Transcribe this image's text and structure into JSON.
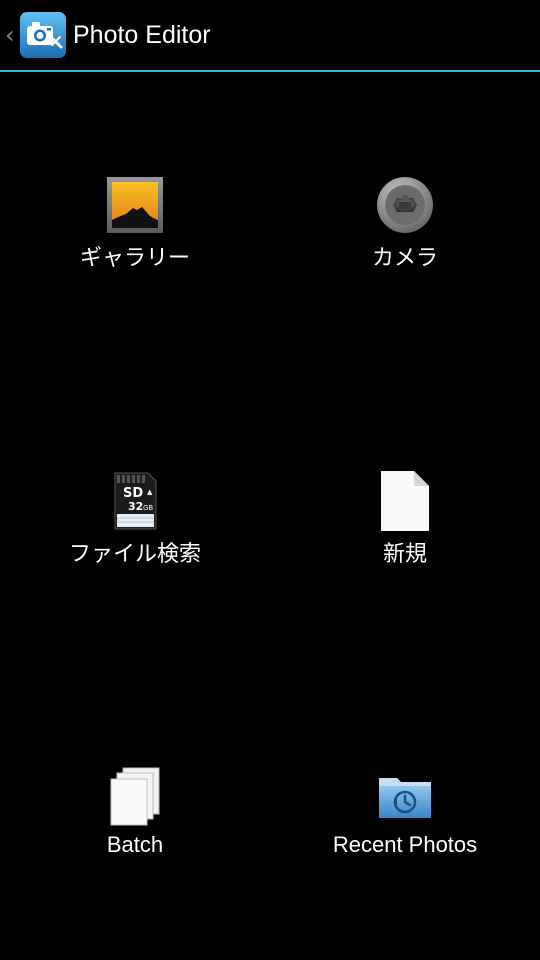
{
  "action_bar": {
    "title": "Photo Editor",
    "icon": "camera-app-icon",
    "up_icon": "chevron-left-icon",
    "divider_color": "#33b5e5"
  },
  "menu": {
    "items": [
      {
        "label": "ギャラリー",
        "icon": "gallery-icon"
      },
      {
        "label": "カメラ",
        "icon": "camera-icon"
      },
      {
        "label": "ファイル検索",
        "icon": "sd-card-icon"
      },
      {
        "label": "新規",
        "icon": "new-file-icon"
      },
      {
        "label": "Batch",
        "icon": "batch-icon"
      },
      {
        "label": "Recent Photos",
        "icon": "recent-folder-icon"
      }
    ]
  },
  "sd_card": {
    "brand": "SD",
    "capacity": "32",
    "unit": "GB"
  }
}
